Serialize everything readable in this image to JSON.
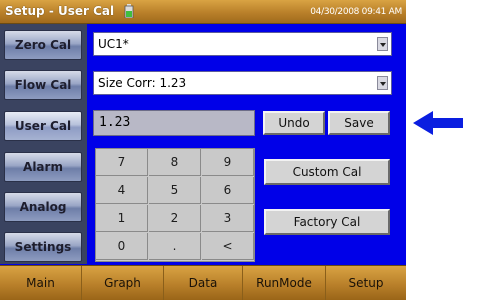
{
  "titlebar": {
    "title": "Setup - User Cal",
    "battery_icon": "battery-icon",
    "datetime": "04/30/2008 09:41 AM"
  },
  "sidebar": {
    "items": [
      {
        "label": "Zero Cal",
        "active": false
      },
      {
        "label": "Flow Cal",
        "active": false
      },
      {
        "label": "User Cal",
        "active": true
      },
      {
        "label": "Alarm",
        "active": false
      },
      {
        "label": "Analog",
        "active": false
      },
      {
        "label": "Settings",
        "active": false
      }
    ]
  },
  "main": {
    "profile_select": {
      "value": "UC1*"
    },
    "size_corr_select": {
      "value": "Size Corr: 1.23"
    },
    "entry_value": "1.23",
    "undo_label": "Undo",
    "save_label": "Save",
    "custom_cal_label": "Custom Cal",
    "factory_cal_label": "Factory Cal",
    "keypad": [
      "7",
      "8",
      "9",
      "4",
      "5",
      "6",
      "1",
      "2",
      "3",
      "0",
      ".",
      "<"
    ]
  },
  "bottom_tabs": [
    {
      "label": "Main"
    },
    {
      "label": "Graph"
    },
    {
      "label": "Data"
    },
    {
      "label": "RunMode"
    },
    {
      "label": "Setup"
    }
  ],
  "annotation": {
    "icon": "arrow-left-icon",
    "color": "#0a1ee0"
  },
  "colors": {
    "screen_background": "#0000e8",
    "title_bar": "#b9802a",
    "sidebar_button": "#9aa6c6"
  }
}
